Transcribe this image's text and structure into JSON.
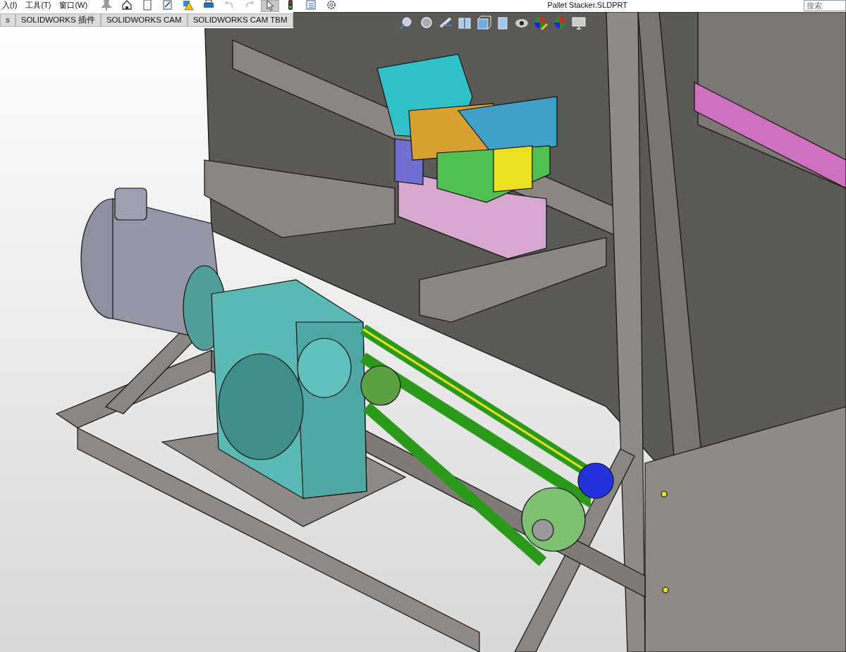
{
  "menu": [
    {
      "label": "入(I)"
    },
    {
      "label": "工具(T)"
    },
    {
      "label": "窗口(W)"
    }
  ],
  "toolbar": [
    {
      "kind": "pin",
      "selected": false
    },
    {
      "kind": "home",
      "selected": false
    },
    {
      "kind": "new",
      "selected": false
    },
    {
      "kind": "sketch",
      "selected": false
    },
    {
      "kind": "warning",
      "selected": false
    },
    {
      "kind": "print",
      "selected": false
    },
    {
      "kind": "undo",
      "selected": false
    },
    {
      "kind": "redo",
      "selected": false
    },
    {
      "kind": "select",
      "selected": true
    },
    {
      "kind": "light",
      "selected": false
    },
    {
      "kind": "list",
      "selected": false
    },
    {
      "kind": "gear",
      "selected": false
    }
  ],
  "title": "Pallet Stacker.SLDPRT",
  "search": {
    "placeholder": "搜索"
  },
  "tabs": [
    {
      "label": "s"
    },
    {
      "label": "SOLIDWORKS 插件"
    },
    {
      "label": "SOLIDWORKS CAM"
    },
    {
      "label": "SOLIDWORKS CAM TBM"
    }
  ],
  "view_toolbar": [
    {
      "kind": "zoom-fit"
    },
    {
      "kind": "zoom-area"
    },
    {
      "kind": "previous-view"
    },
    {
      "kind": "section"
    },
    {
      "kind": "view-orient"
    },
    {
      "kind": "display-style"
    },
    {
      "kind": "hide-show"
    },
    {
      "kind": "appearance"
    },
    {
      "kind": "scene"
    },
    {
      "kind": "monitor"
    }
  ]
}
